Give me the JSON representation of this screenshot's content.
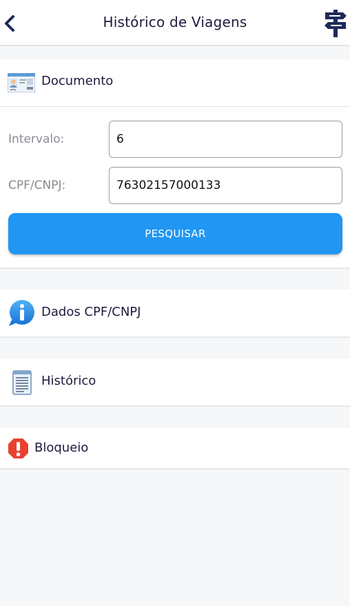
{
  "header": {
    "title": "Histórico de Viagens",
    "back_icon": "chevron-left-icon",
    "action_icon": "signpost-icon"
  },
  "documento": {
    "title": "Documento",
    "icon": "id-card-icon",
    "fields": [
      {
        "label": "Intervalo:",
        "value": "6"
      },
      {
        "label": "CPF/CNPJ:",
        "value": "76302157000133"
      }
    ],
    "search_label": "PESQUISAR"
  },
  "sections": [
    {
      "title": "Dados CPF/CNPJ",
      "icon": "info-icon"
    },
    {
      "title": "Histórico",
      "icon": "document-icon"
    },
    {
      "title": "Bloqueio",
      "icon": "alert-icon"
    }
  ],
  "colors": {
    "accent": "#2196f3",
    "title_text": "#1e1b3f",
    "label_text": "#8a8a94",
    "alert": "#e8422f"
  }
}
